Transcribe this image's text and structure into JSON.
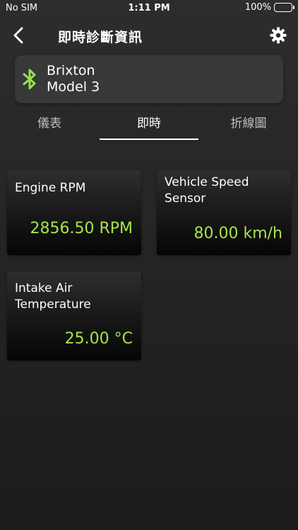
{
  "status_bar": {
    "carrier": "No SIM",
    "time": "1:11 PM",
    "battery": "100%",
    "battery_level": 1.0
  },
  "nav": {
    "title": "即時診斷資訊",
    "back_icon": "chevron-left-icon",
    "settings_icon": "gear-icon"
  },
  "device": {
    "brand": "Brixton",
    "model": "Model 3",
    "icon": "bluetooth-icon",
    "icon_color": "#9be04a"
  },
  "tabs": [
    {
      "label": "儀表",
      "active": false
    },
    {
      "label": "即時",
      "active": true
    },
    {
      "label": "折線圖",
      "active": false
    }
  ],
  "sensors": [
    {
      "label_line1": "Engine RPM",
      "label_line2": "",
      "value": "2856.50 RPM"
    },
    {
      "label_line1": "Vehicle Speed",
      "label_line2": "Sensor",
      "value": "80.00 km/h"
    },
    {
      "label_line1": "Intake Air",
      "label_line2": "Temperature",
      "value": "25.00 °C"
    }
  ],
  "colors": {
    "value_green": "#a6e34a",
    "background": "#262626",
    "card_bg": "#383838"
  }
}
